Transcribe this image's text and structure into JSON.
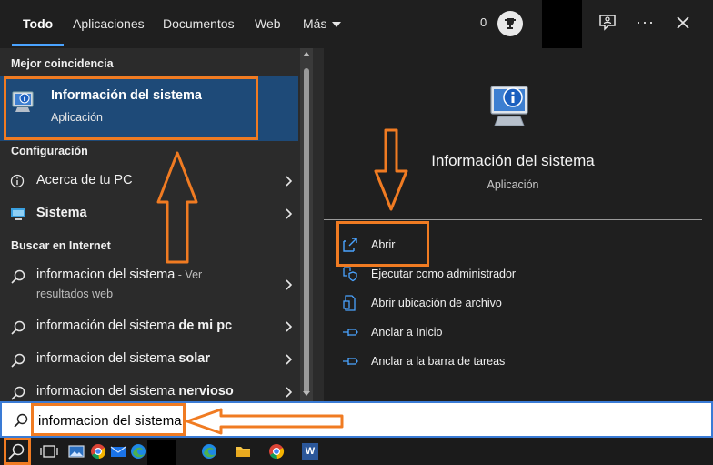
{
  "tabs": [
    {
      "label": "Todo",
      "active": true
    },
    {
      "label": "Aplicaciones"
    },
    {
      "label": "Documentos"
    },
    {
      "label": "Web"
    },
    {
      "label": "Más"
    }
  ],
  "header": {
    "points": "0",
    "icons": [
      "trophy-icon",
      "feedback-icon",
      "more-icon",
      "close-icon"
    ]
  },
  "results": {
    "best_match_header": "Mejor coincidencia",
    "best_match": {
      "title": "Información del sistema",
      "subtitle": "Aplicación",
      "icon": "system-info-icon"
    },
    "settings_header": "Configuración",
    "settings": [
      {
        "label": "Acerca de tu PC",
        "icon": "info-circle-icon"
      },
      {
        "label": "Sistema",
        "icon": "monitor-icon"
      }
    ],
    "web_header": "Buscar en Internet",
    "web": [
      {
        "query": "informacion del sistema",
        "suffix": " - Ver",
        "line2": "resultados web"
      },
      {
        "prefix": "información del sistema ",
        "bold": "de mi pc"
      },
      {
        "prefix": "informacion del sistema ",
        "bold": "solar"
      },
      {
        "prefix": "informacion del sistema ",
        "bold": "nervioso"
      }
    ]
  },
  "detail": {
    "title": "Información del sistema",
    "subtitle": "Aplicación",
    "actions": [
      {
        "label": "Abrir",
        "icon": "open-icon"
      },
      {
        "label": "Ejecutar como administrador",
        "icon": "shield-icon"
      },
      {
        "label": "Abrir ubicación de archivo",
        "icon": "file-location-icon"
      },
      {
        "label": "Anclar a Inicio",
        "icon": "pin-icon"
      },
      {
        "label": "Anclar a la barra de tareas",
        "icon": "pin-icon"
      }
    ]
  },
  "search": {
    "value": "informacion del sistema"
  },
  "taskbar": {
    "icons": [
      "search-icon",
      "task-view-icon",
      "photos-icon",
      "chrome-icon",
      "mail-icon",
      "edge-icon",
      "edge-icon",
      "file-explorer-icon",
      "chrome-icon",
      "word-icon"
    ],
    "word_label": "W"
  },
  "colors": {
    "highlight": "#f07b22",
    "selected": "#1e4a78",
    "accent": "#4aa3ff"
  }
}
